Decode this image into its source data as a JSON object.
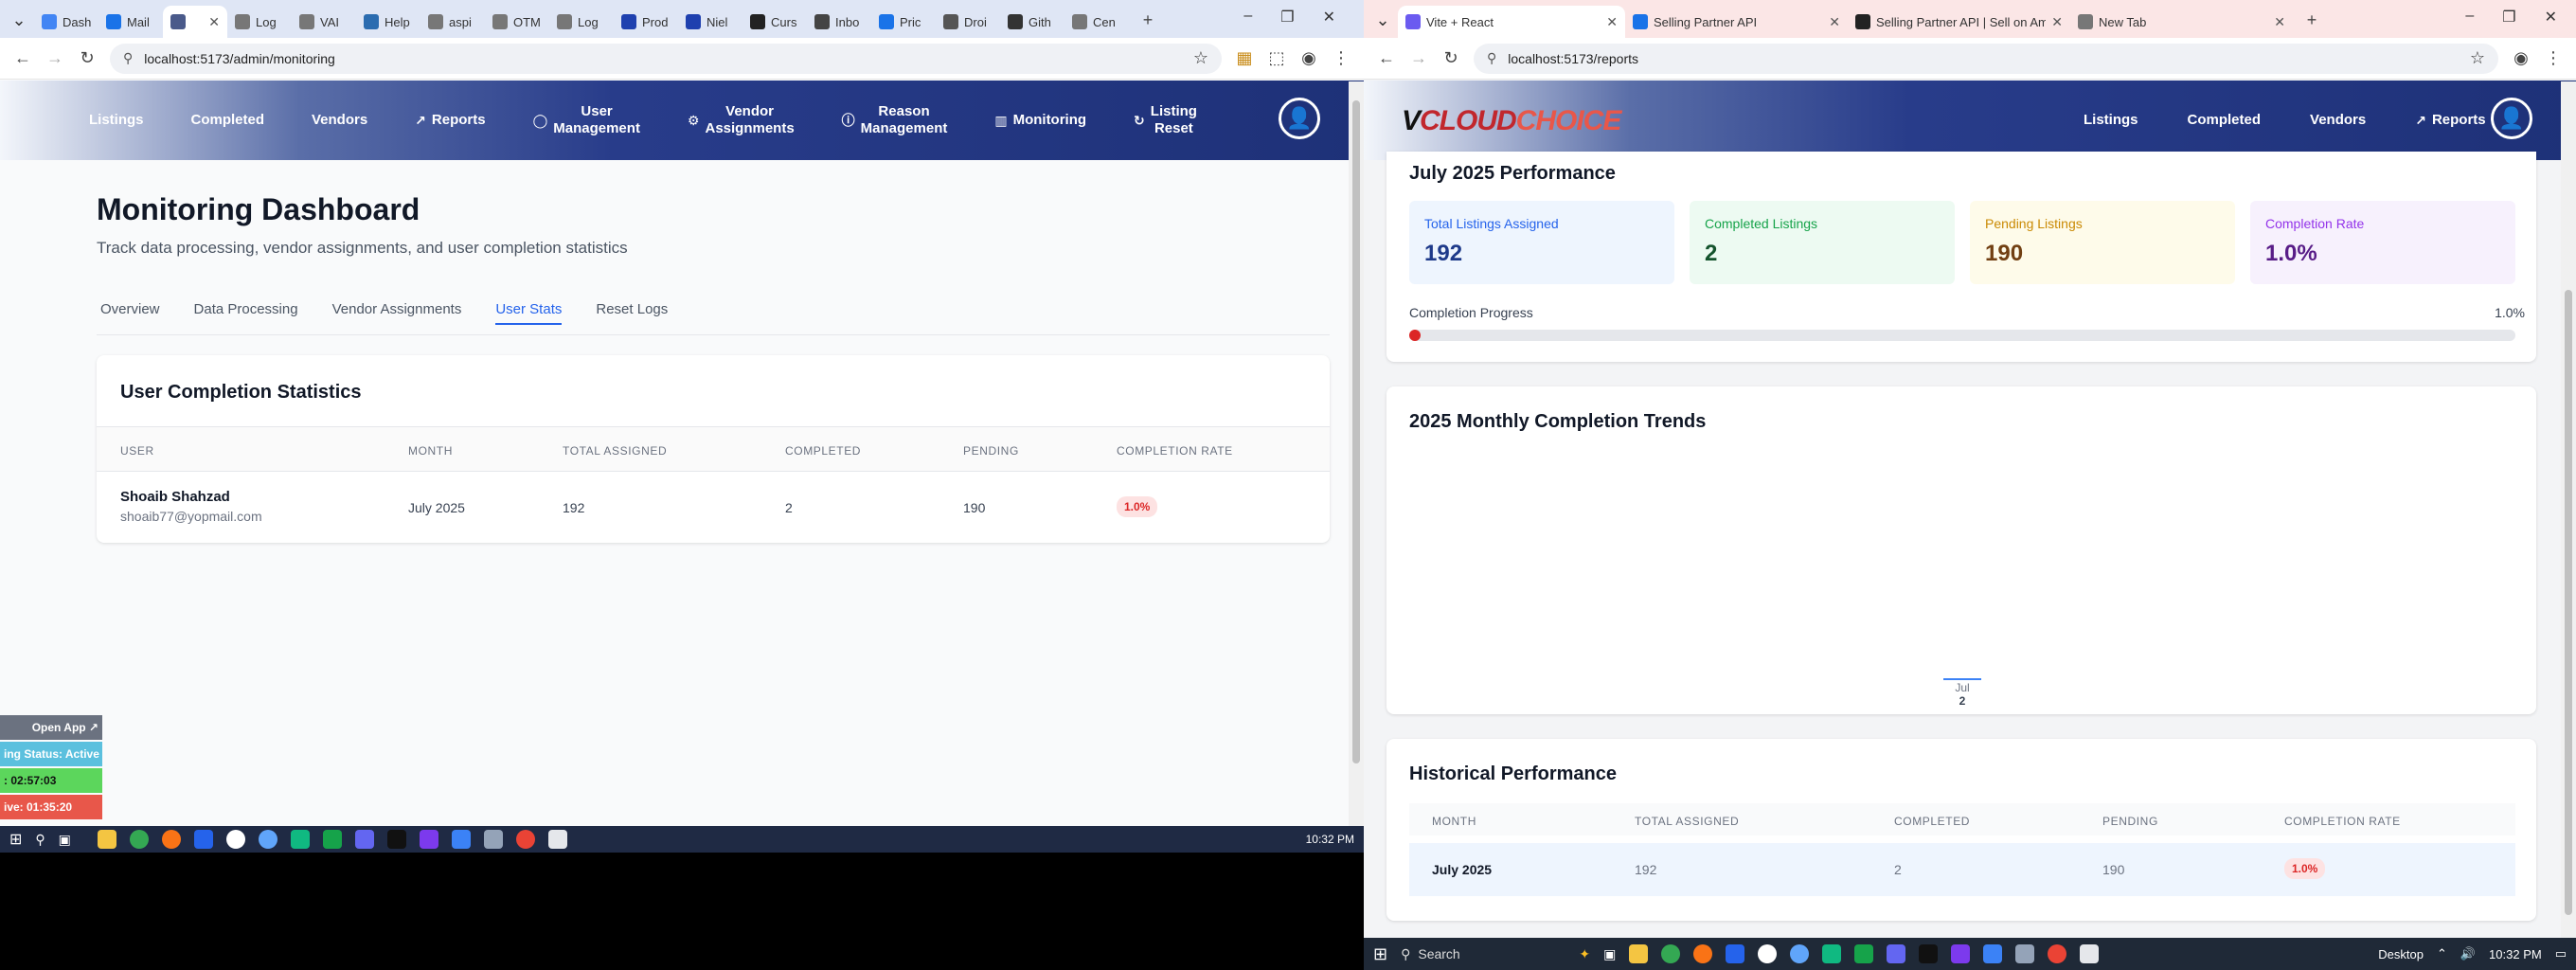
{
  "left": {
    "tabs": [
      {
        "label": "Dash",
        "color": "#4285f4"
      },
      {
        "label": "Mail",
        "color": "#1a73e8"
      },
      {
        "label": "",
        "color": "#4a5a8a",
        "active": true
      },
      {
        "label": "Log",
        "color": "#777777"
      },
      {
        "label": "VAI",
        "color": "#777777"
      },
      {
        "label": "Help",
        "color": "#2b6cb0"
      },
      {
        "label": "aspi",
        "color": "#777777"
      },
      {
        "label": "OTM",
        "color": "#777777"
      },
      {
        "label": "Log",
        "color": "#777777"
      },
      {
        "label": "Prod",
        "color": "#1e40af"
      },
      {
        "label": "Niel",
        "color": "#1e40af"
      },
      {
        "label": "Curs",
        "color": "#222222"
      },
      {
        "label": "Inbo",
        "color": "#444444"
      },
      {
        "label": "Pric",
        "color": "#1a73e8"
      },
      {
        "label": "Droi",
        "color": "#555555"
      },
      {
        "label": "Gith",
        "color": "#333333"
      },
      {
        "label": "Cen",
        "color": "#777777"
      }
    ],
    "url": "localhost:5173/admin/monitoring",
    "nav": [
      {
        "label": "Listings",
        "icon": ""
      },
      {
        "label": "Completed",
        "icon": ""
      },
      {
        "label": "Vendors",
        "icon": ""
      },
      {
        "label": "Reports",
        "icon": "↗"
      },
      {
        "label": "User\nManagement",
        "icon": "◯"
      },
      {
        "label": "Vendor\nAssignments",
        "icon": "⚙"
      },
      {
        "label": "Reason\nManagement",
        "icon": "ⓘ"
      },
      {
        "label": "Monitoring",
        "icon": "▥"
      },
      {
        "label": "Listing\nReset",
        "icon": "↻"
      }
    ],
    "title": "Monitoring Dashboard",
    "subtitle": "Track data processing, vendor assignments, and user completion statistics",
    "subtabs": [
      {
        "label": "Overview"
      },
      {
        "label": "Data Processing"
      },
      {
        "label": "Vendor Assignments"
      },
      {
        "label": "User Stats",
        "active": true
      },
      {
        "label": "Reset Logs"
      }
    ],
    "card_title": "User Completion Statistics",
    "columns": [
      "User",
      "Month",
      "Total Assigned",
      "Completed",
      "Pending",
      "Completion Rate"
    ],
    "row": {
      "name": "Shoaib Shahzad",
      "email": "shoaib77@yopmail.com",
      "month": "July 2025",
      "total": "192",
      "completed": "2",
      "pending": "190",
      "rate": "1.0%"
    },
    "widget": {
      "open_app": "Open App ↗",
      "status": "ing Status: Active",
      "timer1": ": 02:57:03",
      "timer2": "ive: 01:35:20"
    },
    "clock": "10:32 PM"
  },
  "right": {
    "tabs": [
      {
        "label": "Vite + React",
        "color": "#6b5bf0",
        "active": true
      },
      {
        "label": "Selling Partner API",
        "color": "#1a73e8"
      },
      {
        "label": "Selling Partner API | Sell on Am",
        "color": "#222222"
      },
      {
        "label": "New Tab",
        "color": "#777777"
      }
    ],
    "url": "localhost:5173/reports",
    "logo_v": "V",
    "logo_cloud": "CLOUD",
    "logo_choice": "CHOICE",
    "nav": [
      {
        "label": "Listings",
        "icon": ""
      },
      {
        "label": "Completed",
        "icon": ""
      },
      {
        "label": "Vendors",
        "icon": ""
      },
      {
        "label": "Reports",
        "icon": "↗"
      }
    ],
    "perf_title": "July 2025 Performance",
    "stats": [
      {
        "label": "Total Listings Assigned",
        "value": "192",
        "bg": "#eef5fe",
        "fg": "#2563eb",
        "vfg": "#1e3a8a"
      },
      {
        "label": "Completed Listings",
        "value": "2",
        "bg": "#edfaf2",
        "fg": "#16a34a",
        "vfg": "#14532d"
      },
      {
        "label": "Pending Listings",
        "value": "190",
        "bg": "#fefbea",
        "fg": "#ca8a04",
        "vfg": "#713f12"
      },
      {
        "label": "Completion Rate",
        "value": "1.0%",
        "bg": "#f7f1fd",
        "fg": "#9333ea",
        "vfg": "#581c87"
      }
    ],
    "progress_label": "Completion Progress",
    "progress_value": "1.0%",
    "progress_fraction": 0.01,
    "trends_title": "2025 Monthly Completion Trends",
    "chart_data": {
      "type": "bar",
      "categories": [
        "Jul"
      ],
      "values": [
        2
      ]
    },
    "hist_title": "Historical Performance",
    "hist_columns": [
      "Month",
      "Total Assigned",
      "Completed",
      "Pending",
      "Completion Rate"
    ],
    "hist_row": {
      "month": "July 2025",
      "total": "192",
      "completed": "2",
      "pending": "190",
      "rate": "1.0%"
    },
    "search": "Search",
    "desktop": "Desktop",
    "clock": "10:32 PM"
  }
}
